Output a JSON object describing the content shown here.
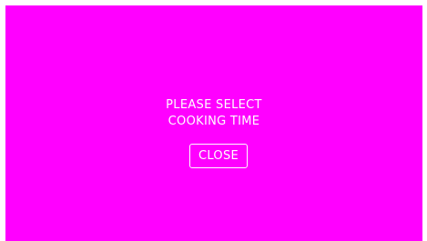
{
  "colors": {
    "background": "#ff00ff",
    "text": "#ffffff",
    "frame": "#ffffff"
  },
  "dialog": {
    "message_line_1": "PLEASE SELECT",
    "message_line_2": "COOKING TIME",
    "close_label": "CLOSE"
  }
}
